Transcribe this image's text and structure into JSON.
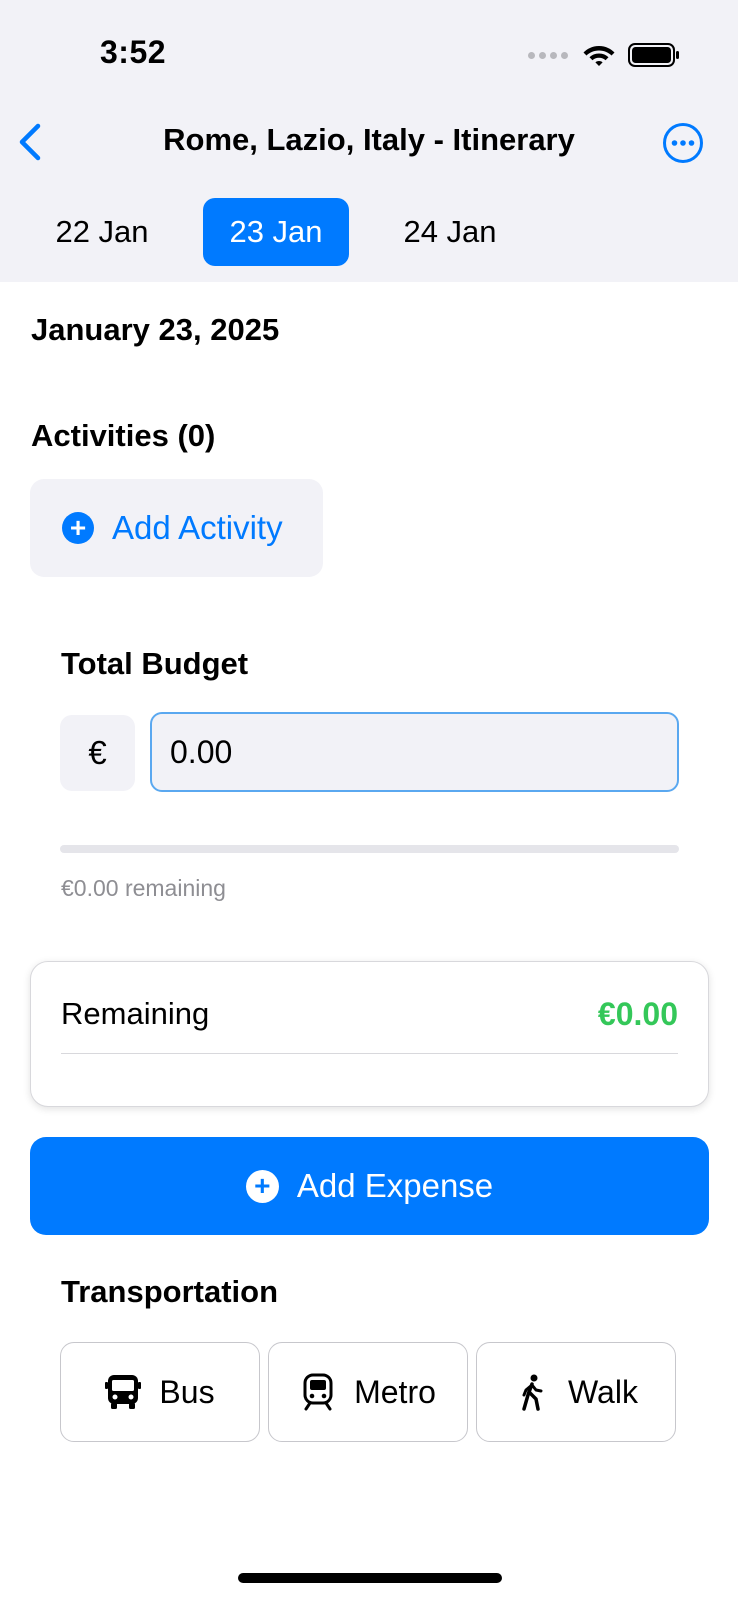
{
  "status_bar": {
    "time": "3:52"
  },
  "nav": {
    "title": "Rome, Lazio, Italy - Itinerary"
  },
  "date_tabs": [
    {
      "label": "22 Jan",
      "selected": false
    },
    {
      "label": "23 Jan",
      "selected": true
    },
    {
      "label": "24 Jan",
      "selected": false
    }
  ],
  "day": {
    "date_heading": "January 23, 2025"
  },
  "activities": {
    "heading": "Activities (0)",
    "add_label": "Add Activity"
  },
  "budget": {
    "heading": "Total Budget",
    "currency_symbol": "€",
    "amount_value": "0.00",
    "progress_fraction": 0,
    "remaining_note": "€0.00 remaining"
  },
  "remaining_card": {
    "label": "Remaining",
    "value": "€0.00"
  },
  "add_expense": {
    "label": "Add Expense"
  },
  "transportation": {
    "heading": "Transportation",
    "options": [
      {
        "label": "Bus",
        "icon": "bus-icon"
      },
      {
        "label": "Metro",
        "icon": "tram-icon"
      },
      {
        "label": "Walk",
        "icon": "walking-person-icon"
      }
    ]
  },
  "colors": {
    "accent": "#007aff",
    "positive": "#34c759",
    "header_background": "#f2f2f7",
    "secondary_text": "#8e8e93"
  }
}
